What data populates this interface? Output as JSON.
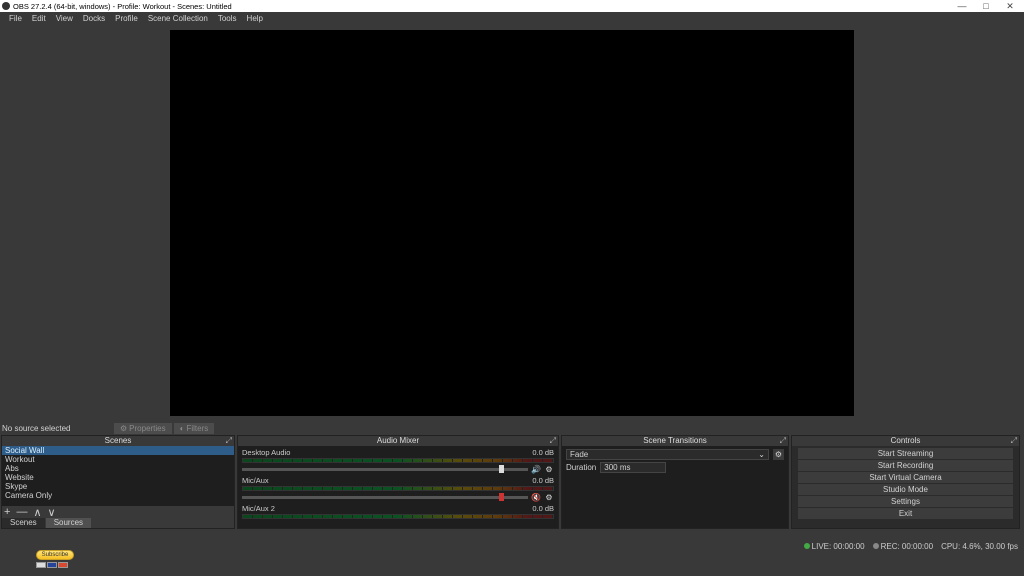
{
  "title": "OBS 27.2.4 (64-bit, windows) - Profile: Workout - Scenes: Untitled",
  "menu": [
    "File",
    "Edit",
    "View",
    "Docks",
    "Profile",
    "Scene Collection",
    "Tools",
    "Help"
  ],
  "no_source": "No source selected",
  "props_btn": "Properties",
  "filters_btn": "Filters",
  "docks": {
    "scenes_title": "Scenes",
    "mixer_title": "Audio Mixer",
    "trans_title": "Scene Transitions",
    "controls_title": "Controls"
  },
  "scenes": {
    "items": [
      "Social Wall",
      "Workout",
      "Abs",
      "Website",
      "Skype",
      "Camera Only"
    ],
    "selected_index": 0,
    "tabs": {
      "scenes": "Scenes",
      "sources": "Sources"
    }
  },
  "mixer": {
    "tracks": [
      {
        "name": "Desktop Audio",
        "db": "0.0 dB",
        "muted": false
      },
      {
        "name": "Mic/Aux",
        "db": "0.0 dB",
        "muted": true
      },
      {
        "name": "Mic/Aux 2",
        "db": "0.0 dB",
        "muted": false
      }
    ]
  },
  "transitions": {
    "type": "Fade",
    "duration_label": "Duration",
    "duration": "300 ms"
  },
  "controls": {
    "buttons": [
      "Start Streaming",
      "Start Recording",
      "Start Virtual Camera",
      "Studio Mode",
      "Settings",
      "Exit"
    ]
  },
  "status": {
    "live": "LIVE: 00:00:00",
    "rec": "REC: 00:00:00",
    "cpu": "CPU: 4.6%, 30.00 fps"
  },
  "subscribe": "Subscribe"
}
